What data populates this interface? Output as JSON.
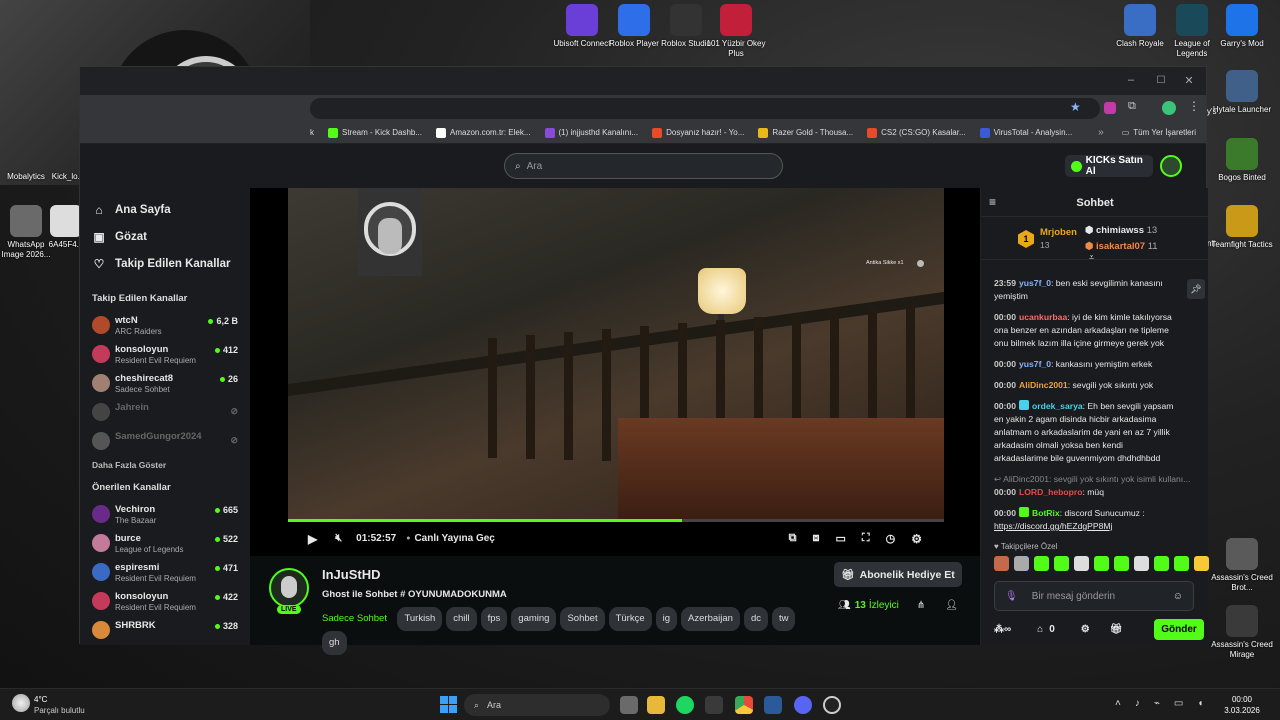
{
  "desktop": {
    "icons_top": [
      {
        "label": "Ubisoft Connect",
        "color": "#6a3fd8"
      },
      {
        "label": "Roblox Player",
        "color": "#2e6ee8"
      },
      {
        "label": "Roblox Studio",
        "color": "#333333"
      },
      {
        "label": "101 Yüzbir Okey Plus",
        "color": "#c2203a"
      }
    ],
    "icons_right": [
      {
        "label": "Clash Royale",
        "color": "#3a6ec4"
      },
      {
        "label": "League of Legends",
        "color": "#1a4a5a"
      },
      {
        "label": "Garry's Mod",
        "color": "#1e73e8"
      },
      {
        "label": "Hytale Launcher",
        "color": "#40608a"
      },
      {
        "label": "Bogos Binted",
        "color": "#3a7a2a"
      },
      {
        "label": "Teamfight Tactics",
        "color": "#c89a18"
      },
      {
        "label": "Assassin's Creed Brot...",
        "color": "#5a5a5a"
      },
      {
        "label": "Assassin's Creed Mirage",
        "color": "#3a3a3a"
      }
    ],
    "icons_left": [
      {
        "label": "Mobalytics"
      },
      {
        "label": "Kick_lo..."
      },
      {
        "label": "WhatsApp Image 2026..."
      },
      {
        "label": "6A45F4..."
      }
    ],
    "right_edge": [
      "y's",
      "nil"
    ]
  },
  "browser": {
    "bookmarks": [
      {
        "label": "k",
        "color": ""
      },
      {
        "label": "Stream - Kick Dashb...",
        "color": "#53fc18"
      },
      {
        "label": "Amazon.com.tr: Elek...",
        "color": "#ffffff"
      },
      {
        "label": "(1) injjusthd Kanalını...",
        "color": "#8a4ad8"
      },
      {
        "label": "Dosyanız hazır! - Yo...",
        "color": "#e84a2a"
      },
      {
        "label": "Razer Gold - Thousa...",
        "color": "#e8b818"
      },
      {
        "label": "CS2 (CS:GO) Kasalar...",
        "color": "#e84a2a"
      },
      {
        "label": "VirusTotal - Analysin...",
        "color": "#3a5ad8"
      }
    ],
    "all_bookmarks": "Tüm Yer İşaretleri"
  },
  "kick": {
    "search_placeholder": "Ara",
    "kicks_button": "KICKs Satın Al",
    "nav": [
      {
        "icon": "home-icon",
        "glyph": "⌂",
        "label": "Ana Sayfa"
      },
      {
        "icon": "browse-icon",
        "glyph": "▣",
        "label": "Gözat"
      },
      {
        "icon": "heart-icon",
        "glyph": "♡",
        "label": "Takip Edilen Kanallar"
      }
    ],
    "followed_title": "Takip Edilen Kanallar",
    "followed": [
      {
        "name": "wtcN",
        "game": "ARC Raiders",
        "viewers": "6,2 B",
        "color": "#b04a2a",
        "live": true
      },
      {
        "name": "konsoloyun",
        "game": "Resident Evil Requiem",
        "viewers": "412",
        "color": "#c43a5a",
        "live": true
      },
      {
        "name": "cheshirecat8",
        "game": "Sadece Sohbet",
        "viewers": "26",
        "color": "#a08070",
        "live": true
      },
      {
        "name": "Jahrein",
        "game": "",
        "viewers": "",
        "color": "#444444",
        "live": false
      },
      {
        "name": "SamedGungor2024",
        "game": "",
        "viewers": "",
        "color": "#555555",
        "live": false
      }
    ],
    "show_more": "Daha Fazla Göster",
    "recommended_title": "Önerilen Kanallar",
    "recommended": [
      {
        "name": "Vechiron",
        "game": "The Bazaar",
        "viewers": "665",
        "color": "#6a2a8a"
      },
      {
        "name": "burce",
        "game": "League of Legends",
        "viewers": "522",
        "color": "#c47a9a"
      },
      {
        "name": "espiresmi",
        "game": "Resident Evil Requiem",
        "viewers": "471",
        "color": "#3a6ac4"
      },
      {
        "name": "konsoloyun",
        "game": "Resident Evil Requiem",
        "viewers": "422",
        "color": "#c43a5a"
      },
      {
        "name": "SHRBRK",
        "game": "",
        "viewers": "328",
        "color": "#d88a3a"
      }
    ]
  },
  "player": {
    "overlay_text": "Antika Sikke x1",
    "time": "01:52:57",
    "live_label": "Canlı Yayına Geç",
    "progress": 0.6
  },
  "stream": {
    "streamer": "InJuStHD",
    "title": "Ghost ile Sohbet  # OYUNUMADOKUNMA",
    "category": "Sadece Sohbet",
    "tags": [
      "Turkish",
      "chill",
      "fps",
      "gaming",
      "Sohbet",
      "Türkçe",
      "ig",
      "Azerbaijan",
      "dc",
      "tw",
      "gh"
    ],
    "live_badge": "LIVE",
    "gift_button": "Abonelik Hediye Et",
    "viewers": "13",
    "viewers_label": "İzleyici"
  },
  "chat": {
    "title": "Sohbet",
    "leaderboard": [
      {
        "rank": "1",
        "name": "Mrjoben",
        "count": "13"
      },
      {
        "name": "chimiawss",
        "count": "13"
      },
      {
        "name": "isakartal07",
        "count": "11"
      }
    ],
    "messages": [
      {
        "time": "23:59",
        "user": "yus7f_0",
        "color": "#8ab4f8",
        "text": "ben eski sevgilimin kanasını yemiştim"
      },
      {
        "time": "00:00",
        "user": "ucankurbaa",
        "color": "#ff6a6a",
        "text": "iyi de kim kimle takılıyorsa ona benzer en azından arkadaşları ne tipleme onu bilmek lazım illa içine girmeye gerek yok"
      },
      {
        "time": "00:00",
        "user": "yus7f_0",
        "color": "#8ab4f8",
        "text": "kankasını yemiştim erkek"
      },
      {
        "time": "00:00",
        "user": "AliDinc2001",
        "color": "#f0a040",
        "text": "sevgili yok sıkıntı yok"
      },
      {
        "time": "00:00",
        "user": "ordek_sarya",
        "color": "#4ad0e8",
        "text": "Eh ben sevgili yapsam en yakin 2 agam disinda hicbir arkadasima anlatmam o arkadaslarim de yani en az 7 yillik arkadasim olmali yoksa ben kendi arkadaslarime bile guvenmiyom dhdhdhbdd"
      },
      {
        "time": "00:00",
        "user": "LORD_hebopro",
        "color": "#e84a4a",
        "text": "müq"
      },
      {
        "time": "00:00",
        "user": "BotRix",
        "color": "#53fc18",
        "text": "discord Sunucumuz :"
      }
    ],
    "reply_to": "AliDinc2001: sevgili yok sıkıntı yok isimli kullanı...",
    "discord_link": "https://discord.gg/hEZdgPP8Mj",
    "subs_label": "Takipçilere Özel",
    "input_placeholder": "Bir mesaj gönderin",
    "points": "0",
    "send": "Gönder"
  },
  "taskbar": {
    "weather_temp": "4°C",
    "weather_desc": "Parçalı bulutlu",
    "search": "Ara",
    "time": "00:00",
    "date": "3.03.2026"
  }
}
